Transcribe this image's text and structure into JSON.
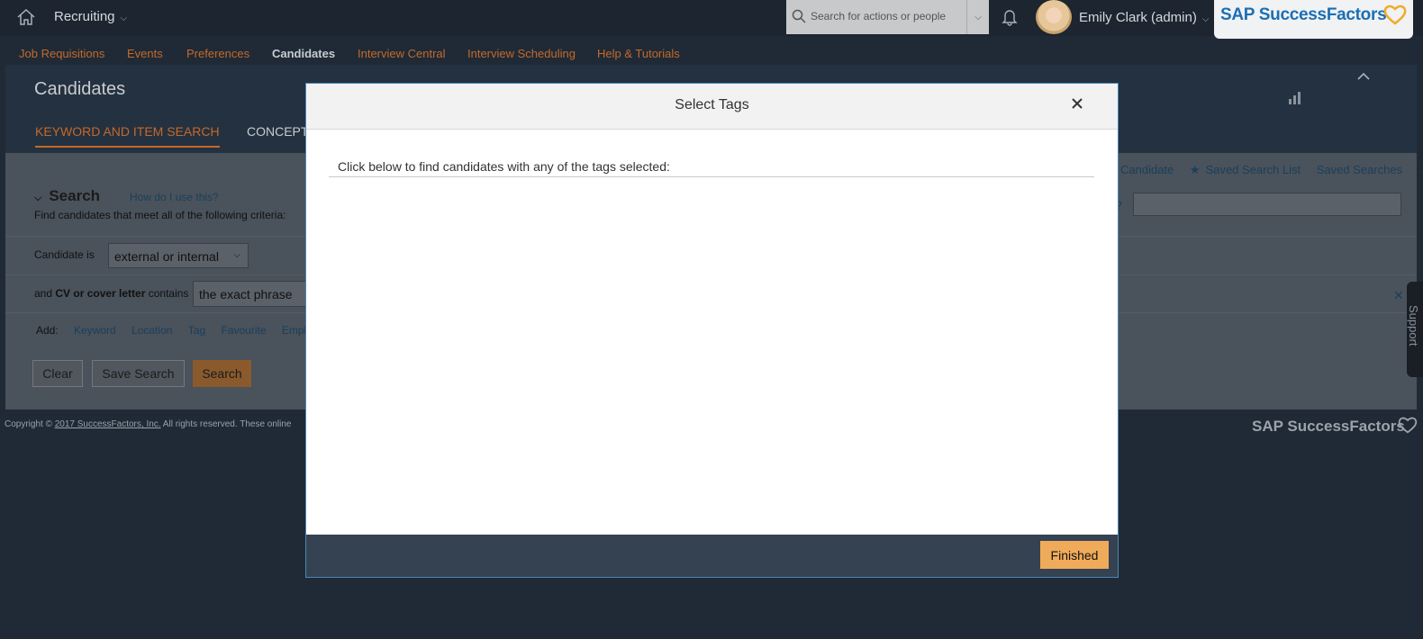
{
  "shell": {
    "module": "Recruiting",
    "search_placeholder": "Search for actions or people",
    "user": "Emily Clark (admin)",
    "brand": "SAP SuccessFactors"
  },
  "nav": [
    "Job Requisitions",
    "Events",
    "Preferences",
    "Candidates",
    "Interview Central",
    "Interview Scheduling",
    "Help & Tutorials"
  ],
  "page": {
    "title": "Candidates",
    "tabs": [
      "KEYWORD AND ITEM SEARCH",
      "CONCEPT"
    ]
  },
  "search": {
    "heading": "Search",
    "help_link": "How do I use this?",
    "criteria_text": "Find candidates that meet all of the following criteria:",
    "candidate_is_label": "Candidate is",
    "candidate_is_value": "external or internal",
    "cv_label_prefix": "and ",
    "cv_label_bold": "CV or cover letter",
    "cv_label_suffix": " contains",
    "cv_value": "the exact phrase",
    "add_label": "Add:",
    "add_links": [
      "Keyword",
      "Location",
      "Tag",
      "Favourite",
      "Empl"
    ],
    "buttons": {
      "clear": "Clear",
      "save": "Save Search",
      "search": "Search"
    }
  },
  "right_links": [
    "Candidate",
    "Saved Search List",
    "Saved Searches"
  ],
  "copyright": {
    "prefix": "Copyright © ",
    "link": "2017 SuccessFactors, Inc.",
    "suffix": " All rights reserved. These online"
  },
  "footer_brand": "SAP SuccessFactors",
  "support": "Support",
  "modal": {
    "title": "Select Tags",
    "instruction": "Click below to find candidates with any of the tags selected:",
    "finished": "Finished"
  },
  "colors": {
    "accent": "#f0ab5a",
    "nav_link": "#c5692a",
    "brand": "#1c6fb3"
  }
}
